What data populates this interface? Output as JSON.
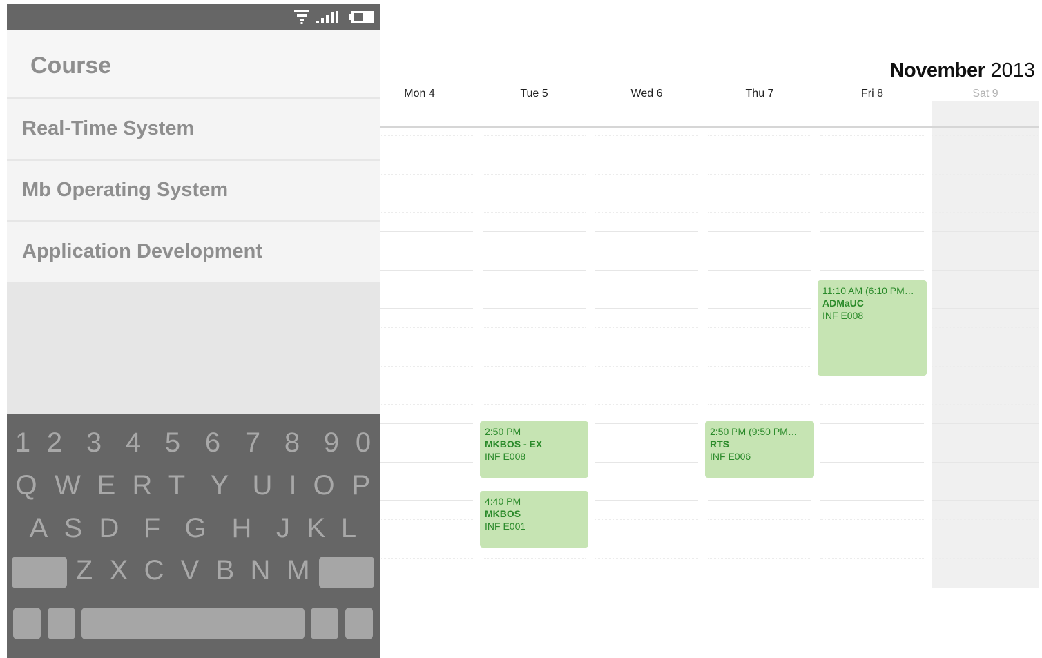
{
  "phone": {
    "status_icons": [
      "wifi-icon",
      "signal-icon",
      "battery-icon"
    ],
    "header": {
      "title": "Course"
    },
    "courses": [
      {
        "label": "Real-Time System"
      },
      {
        "label": "Mb Operating System"
      },
      {
        "label": "Application Development"
      }
    ],
    "keyboard": {
      "row_numbers": [
        "1",
        "2",
        "3",
        "4",
        "5",
        "6",
        "7",
        "8",
        "9",
        "0"
      ],
      "row_qwerty": [
        "Q",
        "W",
        "E",
        "R",
        "T",
        "Y",
        "U",
        "I",
        "O",
        "P"
      ],
      "row_asdf": [
        "A",
        "S",
        "D",
        "F",
        "G",
        "H",
        "J",
        "K",
        "L"
      ],
      "row_zxcv": [
        "Z",
        "X",
        "C",
        "V",
        "B",
        "N",
        "M"
      ]
    }
  },
  "calendar": {
    "month": "November",
    "year": "2013",
    "days": [
      {
        "label": "Mon 4",
        "weekend": false
      },
      {
        "label": "Tue 5",
        "weekend": false
      },
      {
        "label": "Wed 6",
        "weekend": false
      },
      {
        "label": "Thu 7",
        "weekend": false
      },
      {
        "label": "Fri 8",
        "weekend": false
      },
      {
        "label": "Sat 9",
        "weekend": true
      }
    ],
    "events": [
      {
        "day": "Tue 5",
        "time": "2:50 PM",
        "title": "MKBOS - EX",
        "room": "INF E008"
      },
      {
        "day": "Tue 5",
        "time": "4:40 PM",
        "title": "MKBOS",
        "room": "INF E001"
      },
      {
        "day": "Thu 7",
        "time": "2:50 PM (9:50 PM…",
        "title": "RTS",
        "room": "INF E006"
      },
      {
        "day": "Fri 8",
        "time": "11:10 AM (6:10 PM…",
        "title": "ADMaUC",
        "room": "INF E008"
      }
    ],
    "colors": {
      "event_bg": "#c6e4b3",
      "event_text": "#2a8a2a"
    }
  }
}
